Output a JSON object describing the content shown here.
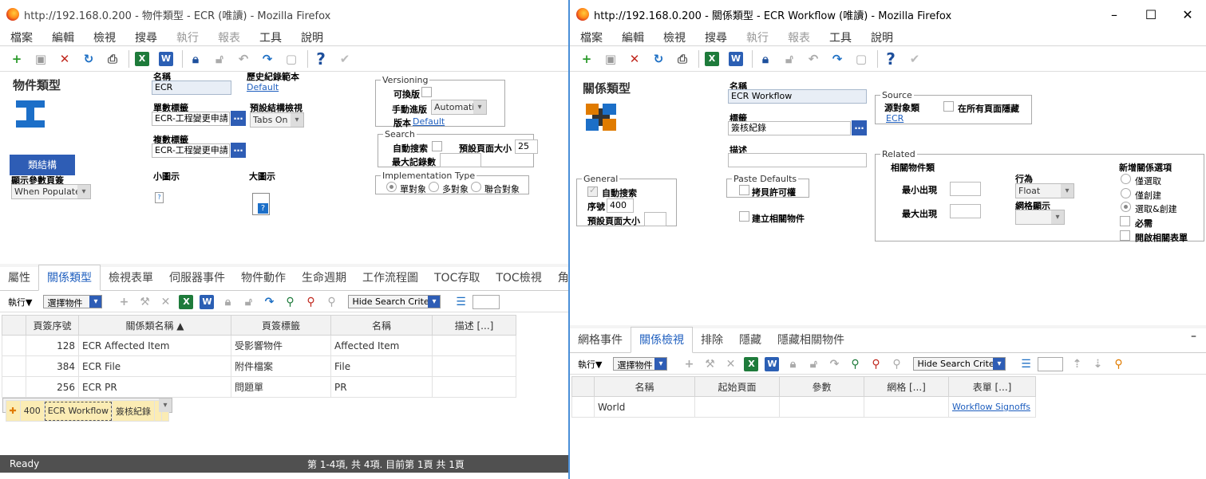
{
  "w1": {
    "title": "http://192.168.0.200 - 物件類型 - ECR (唯讀) - Mozilla Firefox",
    "menu": [
      "檔案",
      "編輯",
      "檢視",
      "搜尋",
      "執行",
      "報表",
      "工具",
      "說明"
    ],
    "form_title": "物件類型",
    "class_button": "類結構",
    "name_label": "名稱",
    "name_value": "ECR",
    "history_label": "歷史紀錄範本",
    "history_link": "Default",
    "single_label": "單數標籤",
    "single_value": "ECR-工程變更申請",
    "default_view_label": "預設結構檢視",
    "default_view_value": "Tabs On",
    "plural_label": "複數標籤",
    "plural_value": "ECR-工程變更申請",
    "small_icon_label": "小圖示",
    "large_icon_label": "大圖示",
    "show_params_label": "顯示參數頁簽",
    "show_params_value": "When Populated",
    "versioning_legend": "Versioning",
    "versionable_label": "可換版",
    "manual_rev_label": "手動進版",
    "manual_rev_value": "Automatic",
    "version_label": "版本",
    "version_link": "Default",
    "search_legend": "Search",
    "auto_search_label": "自動搜索",
    "page_size_label": "預設頁面大小",
    "page_size_value": "25",
    "max_records_label": "最大記錄數",
    "impl_legend": "Implementation Type",
    "impl_options": [
      "單對象",
      "多對象",
      "聯合對象"
    ],
    "tabs": [
      "屬性",
      "關係類型",
      "檢視表單",
      "伺服器事件",
      "物件動作",
      "生命週期",
      "工作流程圖",
      "TOC存取",
      "TOC檢視",
      "角"
    ],
    "grid_exec": "執行▼",
    "grid_select": "選擇物件",
    "grid_search": "Hide Search Criteria",
    "columns": [
      "頁簽序號",
      "關係類名稱 ▲",
      "頁簽標籤",
      "名稱",
      "描述 [...]"
    ],
    "rows": [
      {
        "seq": "128",
        "rel": "ECR Affected Item",
        "tab": "受影響物件",
        "name": "Affected Item"
      },
      {
        "seq": "384",
        "rel": "ECR File",
        "tab": "附件檔案",
        "name": "File"
      },
      {
        "seq": "256",
        "rel": "ECR PR",
        "tab": "問題單",
        "name": "PR"
      },
      {
        "seq": "400",
        "rel": "ECR Workflow",
        "tab": "簽核紀錄",
        "name": ""
      }
    ],
    "status_ready": "Ready",
    "status_page": "第 1-4項, 共 4項. 目前第 1頁 共 1頁"
  },
  "w2": {
    "title": "http://192.168.0.200 - 關係類型 - ECR Workflow (唯讀) - Mozilla Firefox",
    "menu": [
      "檔案",
      "編輯",
      "檢視",
      "搜尋",
      "執行",
      "報表",
      "工具",
      "說明"
    ],
    "form_title": "關係類型",
    "name_label": "名稱",
    "name_value": "ECR Workflow",
    "label_label": "標籤",
    "label_value": "簽核紀錄",
    "desc_label": "描述",
    "source_legend": "Source",
    "source_type_label": "源對象類",
    "source_link": "ECR",
    "hide_all_label": "在所有頁面隱藏",
    "general_legend": "General",
    "auto_search_label": "自動搜索",
    "seq_label": "序號",
    "seq_value": "400",
    "page_size_label": "預設頁面大小",
    "paste_legend": "Paste Defaults",
    "copy_perm_label": "拷貝許可權",
    "create_related_label": "建立相關物件",
    "related_legend": "Related",
    "related_type_label": "相關物件類",
    "min_label": "最小出現",
    "max_label": "最大出現",
    "behavior_label": "行為",
    "behavior_value": "Float",
    "grid_view_label": "網格顯示",
    "new_rel_label": "新增關係選項",
    "new_rel_options": [
      "僅選取",
      "僅創建",
      "選取&創建"
    ],
    "required_label": "必需",
    "hide_related_label": "開啟相關表單",
    "tabs": [
      "網格事件",
      "關係檢視",
      "排除",
      "隱藏",
      "隱藏相關物件"
    ],
    "grid_exec": "執行▼",
    "grid_select": "選擇物件",
    "grid_search": "Hide Search Criteria",
    "columns": [
      "名稱",
      "起始頁面",
      "參數",
      "網格 [...]",
      "表單 [...]"
    ],
    "rows": [
      {
        "name": "World",
        "form": "Workflow Signoffs"
      }
    ]
  }
}
